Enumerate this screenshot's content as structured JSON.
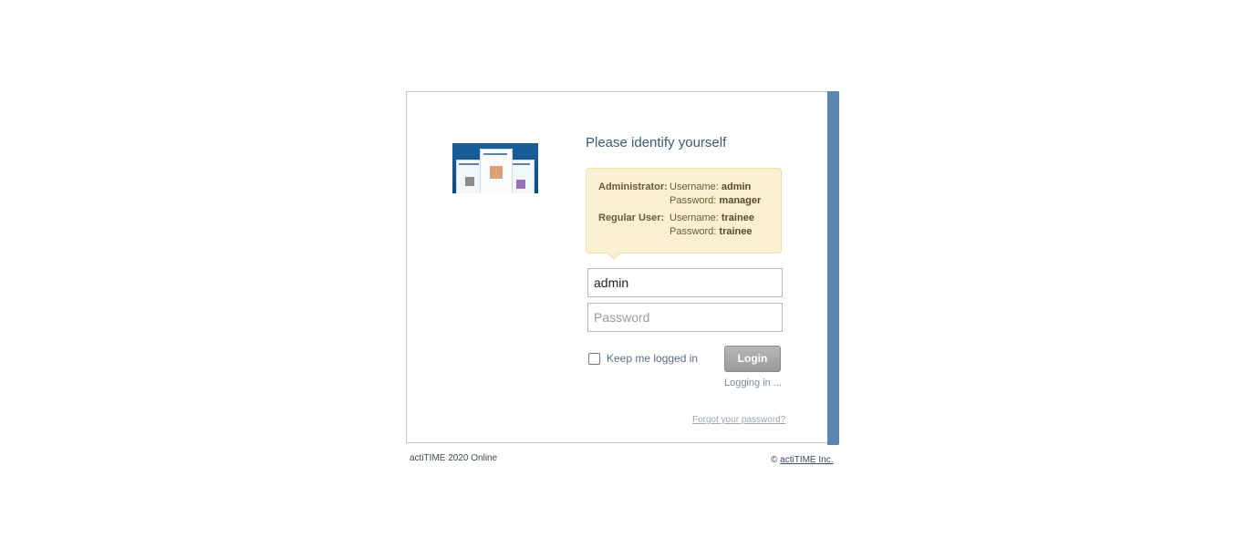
{
  "login": {
    "title": "Please identify yourself",
    "hints": [
      {
        "role": "Administrator:",
        "username_label": "Username:",
        "username": "admin",
        "password_label": "Password:",
        "password": "manager"
      },
      {
        "role": "Regular User:",
        "username_label": "Username:",
        "username": "trainee",
        "password_label": "Password:",
        "password": "trainee"
      }
    ],
    "username_value": "admin",
    "password_placeholder": "Password",
    "keep_logged_label": "Keep me logged in",
    "keep_logged_checked": false,
    "login_button": "Login",
    "status": "Logging in ...",
    "forgot_link": "Forgot your password?"
  },
  "footer": {
    "version": "actiTIME 2020 Online",
    "copyright_symbol": "©",
    "company": "actiTIME Inc."
  },
  "colors": {
    "accent": "#5b84b1",
    "hint_background": "#f8f0d0",
    "title_text": "#3b5a76"
  }
}
